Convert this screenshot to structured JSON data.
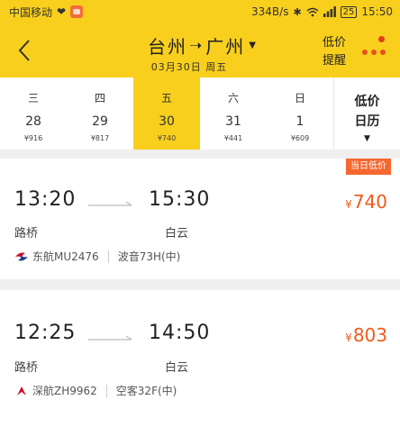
{
  "status_bar": {
    "carrier": "中国移动",
    "speed": "334B/s",
    "battery": "25",
    "time": "15:50"
  },
  "header": {
    "origin": "台州",
    "destination": "广州",
    "date": "03月30日 周五",
    "alert_line1": "低价",
    "alert_line2": "提醒"
  },
  "date_strip": {
    "days": [
      {
        "weekday": "三",
        "day": "28",
        "price": "¥916"
      },
      {
        "weekday": "四",
        "day": "29",
        "price": "¥817"
      },
      {
        "weekday": "五",
        "day": "30",
        "price": "¥740"
      },
      {
        "weekday": "六",
        "day": "31",
        "price": "¥441"
      },
      {
        "weekday": "日",
        "day": "1",
        "price": "¥609"
      }
    ],
    "selected_index": 2,
    "calendar_line1": "低价",
    "calendar_line2": "日历"
  },
  "flights": [
    {
      "badge": "当日低价",
      "dep_time": "13:20",
      "arr_time": "15:30",
      "dep_airport": "路桥",
      "arr_airport": "白云",
      "airline": "东航MU2476",
      "aircraft": "波音73H(中)",
      "currency": "¥",
      "price": "740"
    },
    {
      "dep_time": "12:25",
      "arr_time": "14:50",
      "dep_airport": "路桥",
      "arr_airport": "白云",
      "airline": "深航ZH9962",
      "aircraft": "空客32F(中)",
      "currency": "¥",
      "price": "803"
    }
  ],
  "colors": {
    "brand_yellow": "#f9cf1e",
    "price_orange": "#f3591a",
    "badge_orange": "#f46830"
  }
}
